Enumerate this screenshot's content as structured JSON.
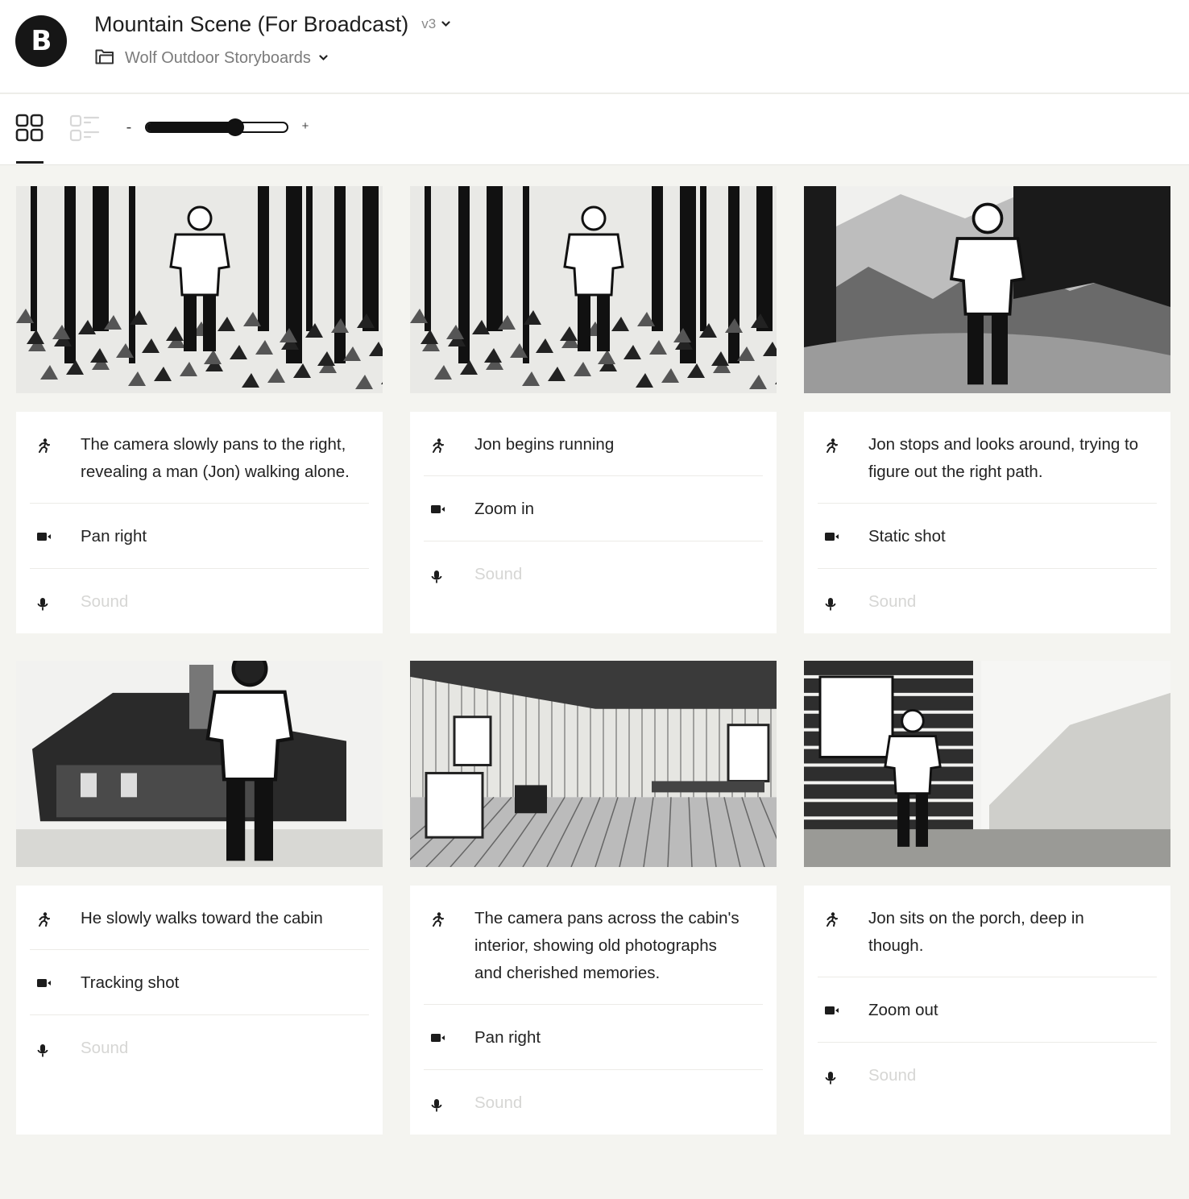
{
  "header": {
    "logo_letter": "B",
    "title": "Mountain Scene (For Broadcast)",
    "version": "v3",
    "project": "Wolf Outdoor Storyboards",
    "project_icon": "folder-icon"
  },
  "toolbar": {
    "views": [
      {
        "name": "grid-view",
        "icon": "grid-icon",
        "active": true
      },
      {
        "name": "list-view",
        "icon": "list-icon",
        "active": false
      }
    ],
    "zoom_minus": "-",
    "zoom_plus": "+",
    "zoom_level_percent": 63
  },
  "colors": {
    "page_bg": "#f4f4f0",
    "card_bg": "#ffffff",
    "text": "#222222",
    "placeholder": "#d6d6d4",
    "accent": "#111111"
  },
  "frames": [
    {
      "image": "forest-walking",
      "action": "The camera slowly pans to the right, revealing a man (Jon) walking alone.",
      "camera": "Pan right",
      "sound_placeholder": "Sound"
    },
    {
      "image": "forest-running",
      "action": "Jon begins running",
      "camera": "Zoom in",
      "sound_placeholder": "Sound"
    },
    {
      "image": "mountain-lookout",
      "action": "Jon stops and looks around, trying to figure out the right path.",
      "camera": "Static shot",
      "sound_placeholder": "Sound"
    },
    {
      "image": "cabin-exterior",
      "action": "He slowly walks toward the cabin",
      "camera": "Tracking shot",
      "sound_placeholder": "Sound"
    },
    {
      "image": "cabin-interior",
      "action": "The camera pans across the cabin's interior, showing old photographs and cherished memories.",
      "camera": "Pan right",
      "sound_placeholder": "Sound"
    },
    {
      "image": "porch-sitting",
      "action": "Jon sits on the porch, deep in though.",
      "camera": "Zoom out",
      "sound_placeholder": "Sound"
    }
  ]
}
